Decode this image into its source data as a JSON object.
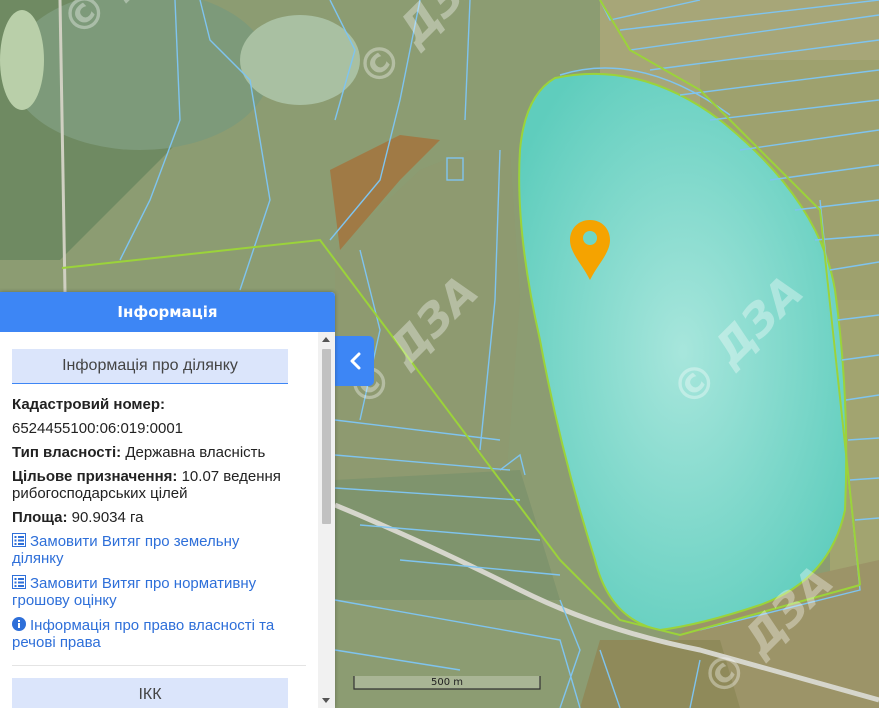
{
  "panel": {
    "title": "Інформація",
    "section_title": "Інформація про ділянку",
    "cadastral_label": "Кадастровий номер:",
    "cadastral_value": "6524455100:06:019:0001",
    "ownership_label": "Тип власності:",
    "ownership_value": "Державна власність",
    "purpose_label": "Цільове призначення:",
    "purpose_value_line1": "10.07  ведення",
    "purpose_value_line2": "рибогосподарських цілей",
    "area_label": "Площа:",
    "area_value": "90.9034 га",
    "link1_line1": "Замовити Витяг про земельну",
    "link1_line2": "ділянку",
    "link2_line1": "Замовити Витяг про нормативну",
    "link2_line2": "грошову оцінку",
    "link3_line1": "Інформація про право власності та",
    "link3_line2": "речові права",
    "next_section_title": "ІКК"
  },
  "map": {
    "watermark": "© ДЗА",
    "scale_label": "500 m",
    "marker_color": "#f5a300",
    "water_color": "#6fd6c4",
    "boundary_color": "#9bd33a",
    "parcel_color": "#7fc4ef"
  },
  "colors": {
    "accent": "#3d86f5",
    "link": "#2e6fd9"
  }
}
